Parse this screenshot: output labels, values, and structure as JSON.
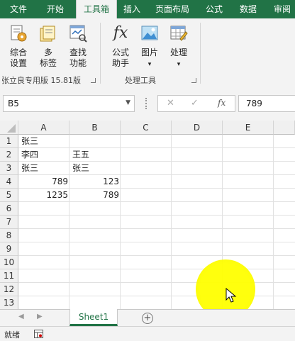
{
  "ribbon_tabs": [
    "文件",
    "开始",
    "工具箱",
    "插入",
    "页面布局",
    "公式",
    "数据",
    "审阅"
  ],
  "active_tab": "工具箱",
  "ribbon": {
    "group1": {
      "buttons": [
        {
          "label_line1": "综合",
          "label_line2": "设置",
          "icon": "settings-doc-icon"
        },
        {
          "label_line1": "多",
          "label_line2": "标签",
          "icon": "multi-tab-icon"
        },
        {
          "label_line1": "查找",
          "label_line2": "功能",
          "icon": "find-function-icon"
        }
      ],
      "label": "张立良专用版 15.81版"
    },
    "group2": {
      "buttons": [
        {
          "label_line1": "公式",
          "label_line2": "助手",
          "icon": "fx-icon",
          "glyph": "fx"
        },
        {
          "label_line1": "图片",
          "label_line2": "▾",
          "icon": "picture-icon"
        },
        {
          "label_line1": "处理",
          "label_line2": "▾",
          "icon": "table-process-icon"
        }
      ],
      "label": "处理工具"
    }
  },
  "formula_bar": {
    "name_box": "B5",
    "cancel_glyph": "✕",
    "confirm_glyph": "✓",
    "fx_glyph": "fx",
    "value": "789"
  },
  "sheet": {
    "columns": [
      "A",
      "B",
      "C",
      "D",
      "E"
    ],
    "rows": [
      "1",
      "2",
      "3",
      "4",
      "5",
      "6",
      "7",
      "8",
      "9",
      "10",
      "11",
      "12",
      "13"
    ],
    "cells": {
      "A1": "张三",
      "A2": "李四",
      "B2": "王五",
      "A3": "张三",
      "B3": "张三",
      "A4": "789",
      "B4": "123",
      "A5": "1235",
      "B5": "789"
    }
  },
  "sheet_tabs": [
    "Sheet1"
  ],
  "add_sheet_glyph": "+",
  "status": {
    "text": "就绪"
  },
  "colors": {
    "accent": "#217346",
    "highlight": "#ffff00"
  }
}
